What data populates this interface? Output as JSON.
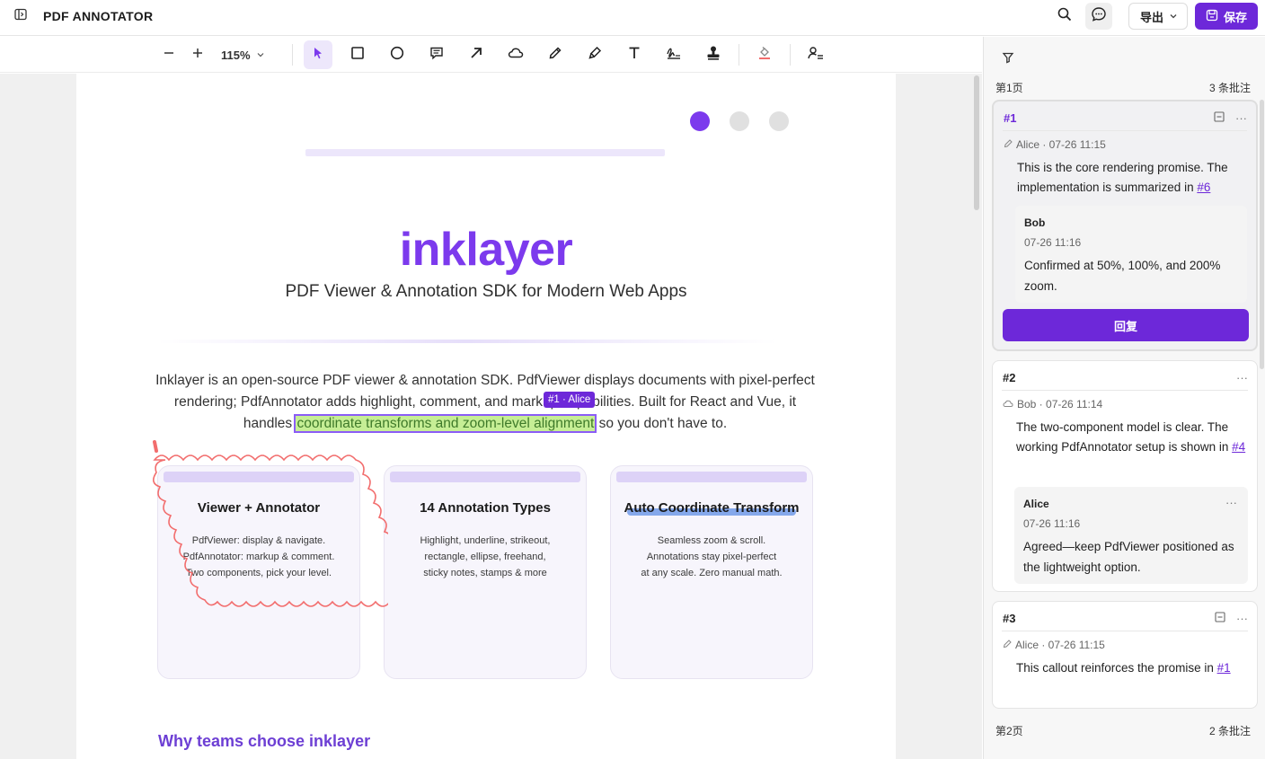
{
  "header": {
    "title": "PDF ANNOTATOR",
    "export_label": "导出",
    "save_label": "保存"
  },
  "toolbar": {
    "zoom": "115%",
    "tools": [
      "select",
      "rectangle",
      "ellipse",
      "comment",
      "arrow",
      "cloud",
      "pen",
      "highlighter",
      "text",
      "signature",
      "stamp",
      "fill",
      "user-settings"
    ],
    "active_tool": "select"
  },
  "document": {
    "brand": "inklayer",
    "subtitle": "PDF Viewer & Annotation SDK for Modern Web Apps",
    "para": {
      "before": "Inklayer is an open-source PDF viewer & annotation SDK. PdfViewer displays documents with pixel-perfect rendering; PdfAnnotator adds highlight, comment, and markup capabilities. Built for React and Vue, it handles ",
      "highlight": "coordinate transforms and zoom-level alignment",
      "after": " so you don't have to."
    },
    "tag_label": "#1 · Alice",
    "cards": [
      {
        "title": "Viewer + Annotator",
        "lines": [
          "PdfViewer: display & navigate.",
          "PdfAnnotator: markup & comment.",
          "Two components, pick your level."
        ]
      },
      {
        "title": "14 Annotation Types",
        "lines": [
          "Highlight, underline, strikeout,",
          "rectangle, ellipse, freehand,",
          "sticky notes, stamps & more"
        ]
      },
      {
        "title": "Auto Coordinate Transform",
        "lines": [
          "Seamless zoom & scroll.",
          "Annotations stay pixel-perfect",
          "at any scale. Zero manual math."
        ]
      }
    ],
    "section_heading": "Why teams choose inklayer"
  },
  "sidebar": {
    "page1": {
      "label": "第1页",
      "count": "3 条批注"
    },
    "page2": {
      "label": "第2页",
      "count": "2 条批注"
    },
    "comments": [
      {
        "num": "#1",
        "meta": "Alice · 07-26 11:15",
        "text": "This is the core rendering promise. The implementation is summarized in ",
        "link": "#6",
        "reply": {
          "name": "Bob",
          "time": "07-26 11:16",
          "text": "Confirmed at 50%, 100%, and 200% zoom."
        },
        "reply_button": "回复"
      },
      {
        "num": "#2",
        "meta": "Bob · 07-26 11:14",
        "text": "The two-component model is clear. The working PdfAnnotator setup is shown in ",
        "link": "#4",
        "reply": {
          "name": "Alice",
          "time": "07-26 11:16",
          "text": "Agreed—keep PdfViewer positioned as the lightweight option."
        }
      },
      {
        "num": "#3",
        "meta": "Alice · 07-26 11:15",
        "text": "This callout reinforces the promise in ",
        "link": "#1"
      }
    ]
  },
  "colors": {
    "accent": "#6d28d9",
    "brand": "#7c3aed",
    "highlight": "#c6ee95",
    "cloud": "#f26d6d"
  }
}
